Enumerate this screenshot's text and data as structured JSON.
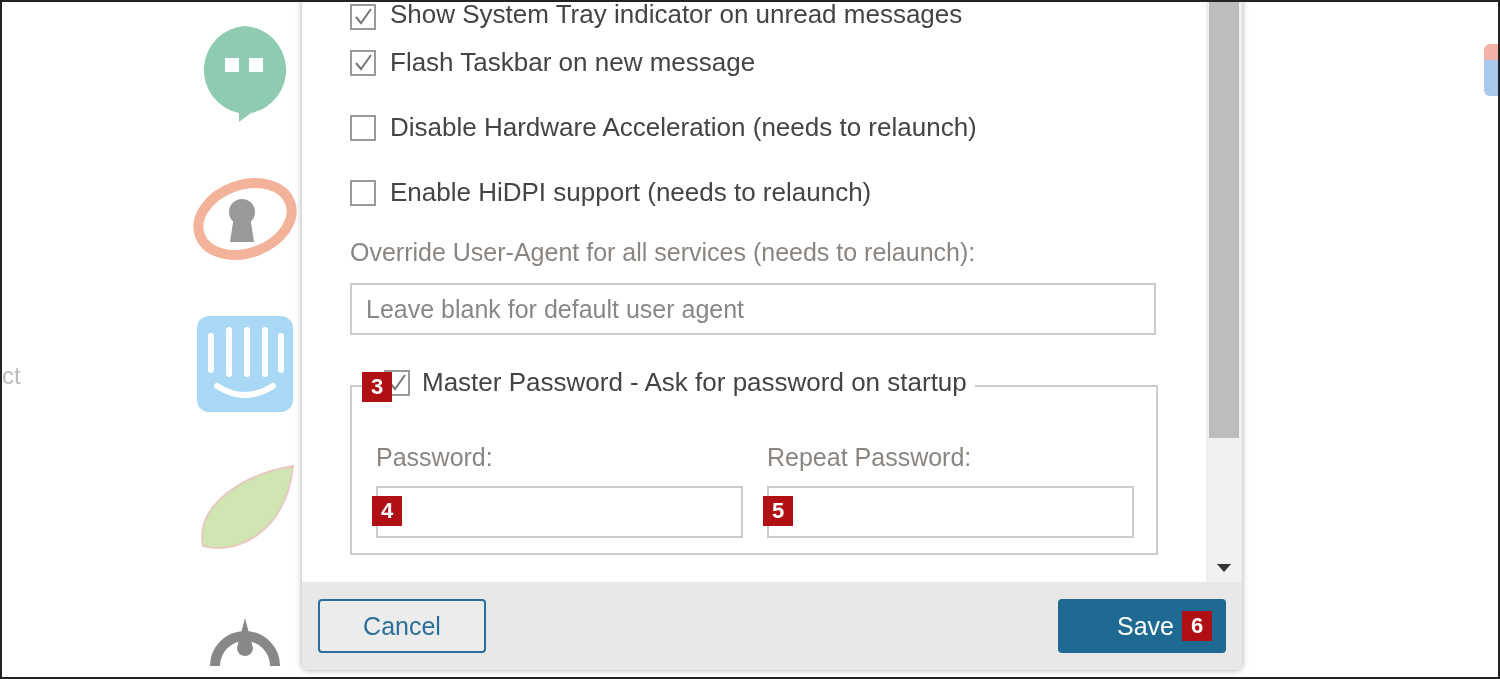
{
  "background": {
    "apps": [
      {
        "kind": "hangouts"
      },
      {
        "kind": "keyhole"
      },
      {
        "kind": "intercom"
      },
      {
        "kind": "leaf"
      },
      {
        "kind": "mattermost"
      }
    ],
    "side_label": "ct"
  },
  "dialog": {
    "options": [
      {
        "label": "Show System Tray indicator on unread messages",
        "checked": true
      },
      {
        "label": "Flash Taskbar on new message",
        "checked": true
      },
      {
        "label": "Disable Hardware Acceleration (needs to relaunch)",
        "checked": false
      },
      {
        "label": "Enable HiDPI support (needs to relaunch)",
        "checked": false
      }
    ],
    "user_agent": {
      "label": "Override User-Agent for all services (needs to relaunch):",
      "placeholder": "Leave blank for default user agent"
    },
    "master_password": {
      "label": "Master Password - Ask for password on startup",
      "checked": true,
      "annotation": "3",
      "fields": [
        {
          "label": "Password:",
          "annotation": "4"
        },
        {
          "label": "Repeat Password:",
          "annotation": "5"
        }
      ]
    },
    "buttons": {
      "cancel": {
        "label": "Cancel"
      },
      "save": {
        "label": "Save",
        "annotation": "6"
      }
    }
  }
}
